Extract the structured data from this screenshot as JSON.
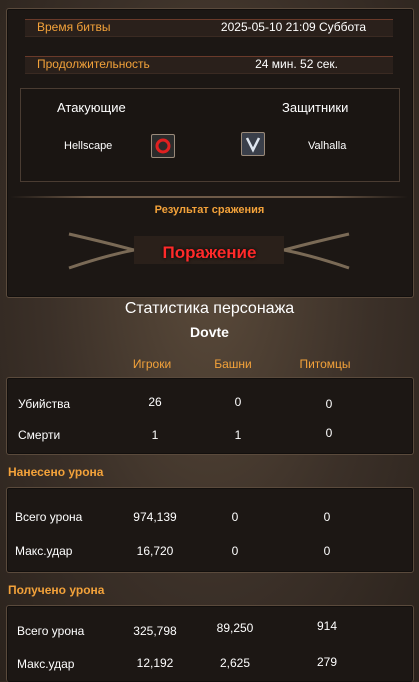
{
  "battle": {
    "time_label": "Время битвы",
    "time_value": "2025-05-10 21:09 Суббота",
    "duration_label": "Продолжительность",
    "duration_value": "24 мин. 52 сек."
  },
  "sides": {
    "attackers_label": "Атакующие",
    "defenders_label": "Защитники",
    "attacker_name": "Hellscape",
    "defender_name": "Valhalla",
    "attacker_icon": "red-ring-emblem-icon",
    "defender_icon": "v-shield-emblem-icon"
  },
  "result": {
    "label": "Результат сражения",
    "value": "Поражение"
  },
  "character": {
    "title": "Статистика персонажа",
    "name": "Dovte",
    "columns": [
      "Игроки",
      "Башни",
      "Питомцы"
    ]
  },
  "combat_stats": {
    "rows": [
      {
        "label": "Убийства",
        "values": [
          "26",
          "0",
          "0"
        ]
      },
      {
        "label": "Смерти",
        "values": [
          "1",
          "1",
          "0"
        ]
      }
    ]
  },
  "damage_dealt": {
    "title": "Нанесено урона",
    "rows": [
      {
        "label": "Всего урона",
        "values": [
          "974,139",
          "0",
          "0"
        ]
      },
      {
        "label": "Макс.удар",
        "values": [
          "16,720",
          "0",
          "0"
        ]
      }
    ]
  },
  "damage_taken": {
    "title": "Получено урона",
    "rows": [
      {
        "label": "Всего урона",
        "values": [
          "325,798",
          "89,250",
          "914"
        ]
      },
      {
        "label": "Макс.удар",
        "values": [
          "12,192",
          "2,625",
          "279"
        ]
      }
    ]
  },
  "colors": {
    "accent_orange": "#f3a23a",
    "result_red": "#ff2a2a",
    "panel_bg": "#1c1714"
  }
}
